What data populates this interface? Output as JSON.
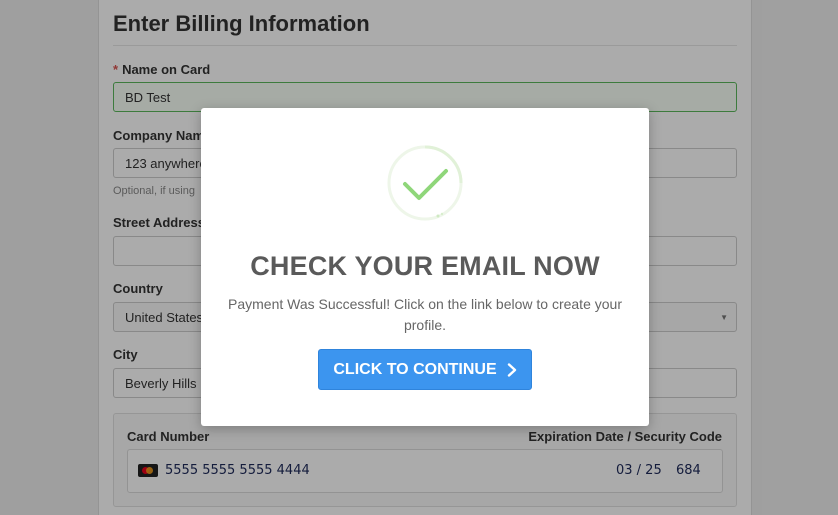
{
  "form": {
    "title": "Enter Billing Information",
    "required_mark": "*",
    "name_label": "Name on Card",
    "name_value": "BD Test",
    "company_label": "Company Name",
    "company_value": "123 anywhere",
    "company_hint": "Optional, if using",
    "street_label": "Street Address",
    "street_value": "",
    "country_label": "Country",
    "country_value": "United States",
    "city_label": "City",
    "city_value": "Beverly Hills"
  },
  "card": {
    "number_label": "Card Number",
    "expiry_label": "Expiration Date / Security Code",
    "number_value": "5555 5555 5555 4444",
    "expiry_value": "03 / 25",
    "cvc_value": "684",
    "brand_icon": "mastercard-icon"
  },
  "modal": {
    "icon": "checkmark-circle-icon",
    "title": "CHECK YOUR EMAIL NOW",
    "message": "Payment Was Successful! Click on the link below to create your profile.",
    "button_label": "CLICK TO CONTINUE",
    "button_icon": "chevron-right-icon"
  },
  "colors": {
    "accent": "#3c95ef",
    "success": "#8fd67a",
    "overlay": "rgba(0,0,0,0.33)"
  }
}
